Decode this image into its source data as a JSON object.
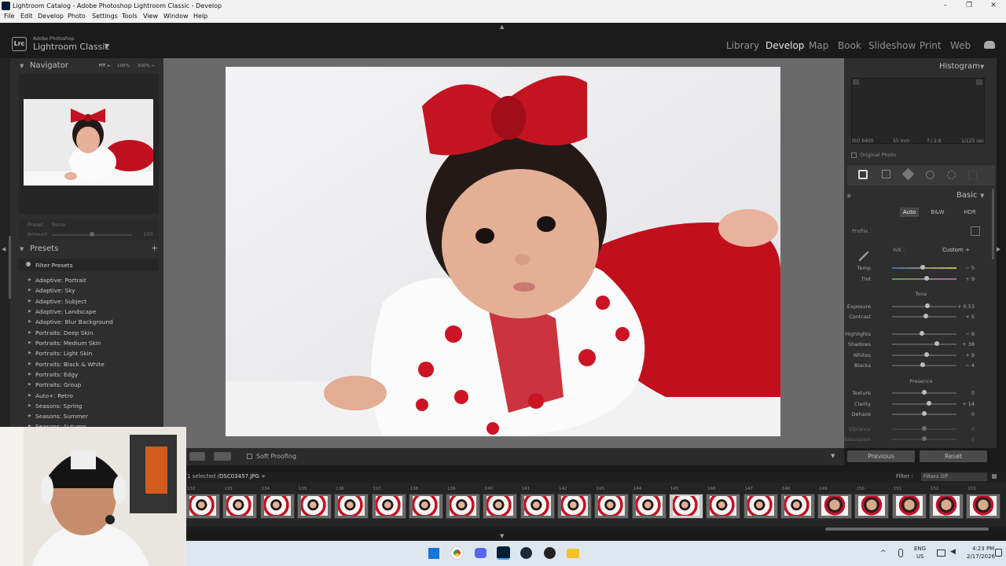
{
  "window": {
    "title": "Lightroom Catalog - Adobe Photoshop Lightroom Classic - Develop",
    "controls": [
      "–",
      "❐",
      "✕"
    ]
  },
  "menu": [
    "File",
    "Edit",
    "Develop",
    "Photo",
    "Settings",
    "Tools",
    "View",
    "Window",
    "Help"
  ],
  "brand": {
    "logo": "Lrc",
    "line1": "Adobe Photoshop",
    "line2": "Lightroom Classic"
  },
  "modules": [
    "Library",
    "Develop",
    "Map",
    "Book",
    "Slideshow",
    "Print",
    "Web"
  ],
  "active_module": "Develop",
  "navigator": {
    "title": "Navigator",
    "zoom": [
      "FIT ÷",
      "100%",
      "300% ÷"
    ]
  },
  "preset_amount": {
    "preset_label": "Preset",
    "preset_value": "None",
    "amount_label": "Amount",
    "amount_value": "100"
  },
  "presets": {
    "title": "Presets",
    "add": "+",
    "filter": "Filter Presets",
    "items": [
      "Adaptive: Portrait",
      "Adaptive: Sky",
      "Adaptive: Subject",
      "Adaptive: Landscape",
      "Adaptive: Blur Background",
      "Portraits: Deep Skin",
      "Portraits: Medium Skin",
      "Portraits: Light Skin",
      "Portraits: Black & White",
      "Portraits: Edgy",
      "Portraits: Group",
      "Auto+: Retro",
      "Seasons: Spring",
      "Seasons: Summer",
      "Seasons: Autumn"
    ]
  },
  "toolbar": {
    "soft_proofing": "Soft Proofing"
  },
  "histogram": {
    "title": "Histogram",
    "iso": "ISO 6400",
    "focal": "55 mm",
    "aperture": "f / 2.8",
    "shutter": "1/125 sec",
    "original_photo": "Original Photo"
  },
  "basic": {
    "title": "Basic",
    "tabs": [
      "Auto",
      "B&W",
      "HDR"
    ],
    "profile_label": "Profile :",
    "wb_label": "WB :",
    "wb_value": "Custom ÷",
    "tone_label": "Tone",
    "presence_label": "Presence",
    "sliders": [
      {
        "label": "Temp",
        "value": "− 5",
        "pos": 0.48
      },
      {
        "label": "Tint",
        "value": "+ 9",
        "pos": 0.54
      },
      {
        "label": "Exposure",
        "value": "+ 0.53",
        "pos": 0.55
      },
      {
        "label": "Contrast",
        "value": "+ 5",
        "pos": 0.52
      },
      {
        "label": "Highlights",
        "value": "− 8",
        "pos": 0.46
      },
      {
        "label": "Shadows",
        "value": "+ 38",
        "pos": 0.69
      },
      {
        "label": "Whites",
        "value": "+ 9",
        "pos": 0.54
      },
      {
        "label": "Blacks",
        "value": "− 4",
        "pos": 0.48
      },
      {
        "label": "Texture",
        "value": "0",
        "pos": 0.5
      },
      {
        "label": "Clarity",
        "value": "+ 14",
        "pos": 0.57
      },
      {
        "label": "Dehaze",
        "value": "0",
        "pos": 0.5
      },
      {
        "label": "Vibrance",
        "value": "0",
        "pos": 0.5
      },
      {
        "label": "Saturation",
        "value": "0",
        "pos": 0.5
      }
    ]
  },
  "buttons": {
    "previous": "Previous",
    "reset": "Reset"
  },
  "filmstrip": {
    "selection": "1 selected /",
    "filename": "DSC03457.JPG ÷",
    "filter_label": "Filter :",
    "filter_value": "Filters Off",
    "numbers": [
      "132",
      "133",
      "134",
      "135",
      "136",
      "137",
      "138",
      "139",
      "140",
      "141",
      "142",
      "143",
      "144",
      "145",
      "146",
      "147",
      "148",
      "149",
      "150",
      "151",
      "152",
      "153"
    ],
    "selected_index": 13
  },
  "taskbar": {
    "lang1": "ENG",
    "lang2": "US",
    "time": "4:23 PM",
    "date": "2/17/2026"
  }
}
